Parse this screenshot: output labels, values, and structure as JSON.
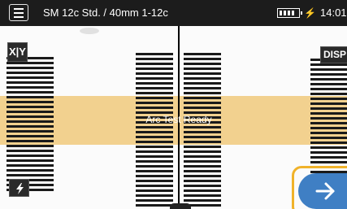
{
  "topbar": {
    "title": "SM 12c Std. / 40mm 1-12c",
    "clock": "14:01",
    "menu_icon": "hamburger-menu-icon",
    "battery_icon": "battery-icon",
    "charging_icon": "lightning-bolt-icon",
    "charging_glyph": "⚡"
  },
  "viewer": {
    "status": "Arc Test Ready",
    "band_color": "#f2d18f"
  },
  "controls": {
    "xy_label": "X|Y",
    "disp_label": "DISP",
    "arc_icon": "lightning-bolt-icon",
    "next_icon": "arrow-right-icon",
    "accent": "#f0b22a",
    "next_color": "#3f7fc4"
  }
}
